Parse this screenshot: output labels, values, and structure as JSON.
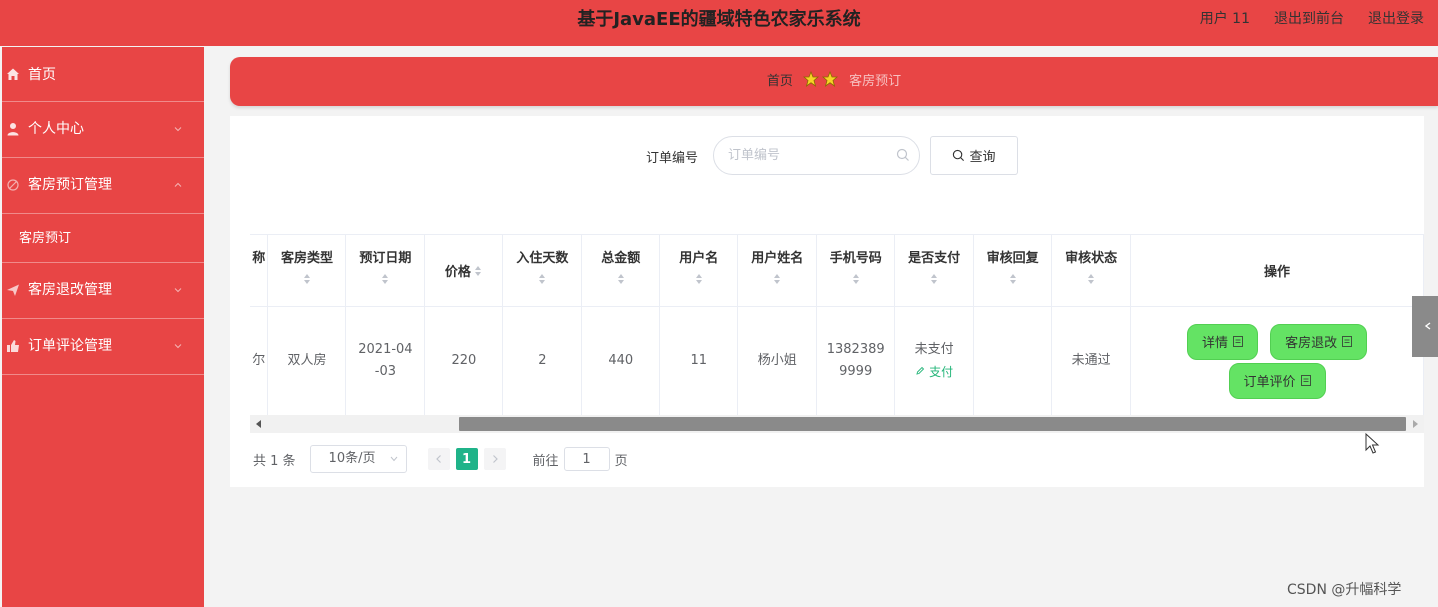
{
  "header": {
    "title": "基于JavaEE的疆域特色农家乐系统",
    "user_link": "用户 11",
    "front_link": "退出到前台",
    "logout_link": "退出登录"
  },
  "sidebar": {
    "items": [
      {
        "label": "首页",
        "icon": "home-icon"
      },
      {
        "label": "个人中心",
        "icon": "user-icon"
      },
      {
        "label": "客房预订管理",
        "icon": "tag-icon"
      },
      {
        "label": "客房退改管理",
        "icon": "plane-icon"
      },
      {
        "label": "订单评论管理",
        "icon": "thumb-icon"
      }
    ],
    "sub_item": "客房预订"
  },
  "breadcrumb": {
    "home": "首页",
    "current": "客房预订"
  },
  "search": {
    "label": "订单编号",
    "placeholder": "订单编号",
    "button": "查询"
  },
  "table": {
    "partial_header": "称",
    "headers": [
      "客房类型",
      "预订日期",
      "价格",
      "入住天数",
      "总金额",
      "用户名",
      "用户姓名",
      "手机号码",
      "是否支付",
      "审核回复",
      "审核状态",
      "操作"
    ],
    "row": {
      "partial_cell": "尔",
      "room_type": "双人房",
      "date_l1": "2021-04",
      "date_l2": "-03",
      "price": "220",
      "days": "2",
      "total": "440",
      "username": "11",
      "name": "杨小姐",
      "phone_l1": "1382389",
      "phone_l2": "9999",
      "paid": "未支付",
      "pay_link": "支付",
      "reply": "",
      "status": "未通过"
    },
    "actions": {
      "detail": "详情",
      "refund": "客房退改",
      "review": "订单评价"
    }
  },
  "pagination": {
    "total": "共 1 条",
    "page_size": "10条/页",
    "current_page": "1",
    "goto_label": "前往",
    "goto_value": "1",
    "goto_suffix": "页"
  },
  "watermark": "CSDN @升幅科学",
  "colors": {
    "primary_red": "#e84545",
    "action_green": "#64e364",
    "page_teal": "#1fb389"
  }
}
